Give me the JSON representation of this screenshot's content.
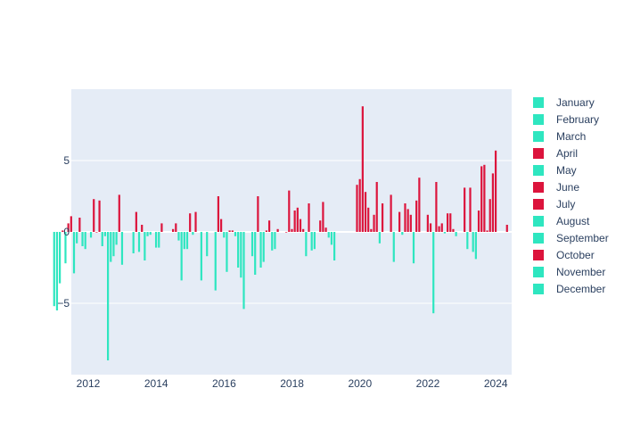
{
  "chart_data": {
    "type": "bar",
    "title": "",
    "xlabel": "",
    "ylabel": "",
    "xlim": [
      2011.55,
      2024.5
    ],
    "ylim": [
      -9.9,
      9.9
    ],
    "grid": true,
    "legend_position": "right",
    "x_ticks": [
      "2012",
      "2014",
      "2016",
      "2018",
      "2020",
      "2022",
      "2024"
    ],
    "x_tick_values": [
      2012,
      2014,
      2016,
      2018,
      2020,
      2022,
      2024
    ],
    "y_ticks": [
      "−5",
      "0",
      "5"
    ],
    "y_tick_values": [
      -5,
      0,
      5
    ],
    "colors": {
      "positive": "#dc143c",
      "negative": "#2ee6c0"
    },
    "legend": [
      {
        "name": "January",
        "color": "#2ee6c0"
      },
      {
        "name": "February",
        "color": "#2ee6c0"
      },
      {
        "name": "March",
        "color": "#2ee6c0"
      },
      {
        "name": "April",
        "color": "#dc143c"
      },
      {
        "name": "May",
        "color": "#2ee6c0"
      },
      {
        "name": "June",
        "color": "#dc143c"
      },
      {
        "name": "July",
        "color": "#dc143c"
      },
      {
        "name": "August",
        "color": "#2ee6c0"
      },
      {
        "name": "September",
        "color": "#2ee6c0"
      },
      {
        "name": "October",
        "color": "#dc143c"
      },
      {
        "name": "November",
        "color": "#2ee6c0"
      },
      {
        "name": "December",
        "color": "#2ee6c0"
      }
    ],
    "series": [
      {
        "date": "2011-09",
        "value": -5.2
      },
      {
        "date": "2011-10",
        "value": -5.5
      },
      {
        "date": "2011-11",
        "value": -3.6
      },
      {
        "date": "2011-12",
        "value": 0.1
      },
      {
        "date": "2012-01",
        "value": -2.2
      },
      {
        "date": "2012-02",
        "value": 0.6
      },
      {
        "date": "2012-03",
        "value": 1.1
      },
      {
        "date": "2012-04",
        "value": -2.9
      },
      {
        "date": "2012-05",
        "value": -0.8
      },
      {
        "date": "2012-06",
        "value": 1.0
      },
      {
        "date": "2012-07",
        "value": -1.0
      },
      {
        "date": "2012-08",
        "value": -1.2
      },
      {
        "date": "2012-10",
        "value": -0.4
      },
      {
        "date": "2012-11",
        "value": 2.3
      },
      {
        "date": "2012-12",
        "value": 0.0
      },
      {
        "date": "2013-01",
        "value": 2.2
      },
      {
        "date": "2013-02",
        "value": -1.0
      },
      {
        "date": "2013-03",
        "value": -0.3
      },
      {
        "date": "2013-04",
        "value": -9.0
      },
      {
        "date": "2013-05",
        "value": -2.1
      },
      {
        "date": "2013-06",
        "value": -1.7
      },
      {
        "date": "2013-07",
        "value": -0.9
      },
      {
        "date": "2013-08",
        "value": 2.6
      },
      {
        "date": "2013-09",
        "value": -2.3
      },
      {
        "date": "2014-01",
        "value": -1.5
      },
      {
        "date": "2014-02",
        "value": 1.4
      },
      {
        "date": "2014-03",
        "value": -1.4
      },
      {
        "date": "2014-04",
        "value": 0.5
      },
      {
        "date": "2014-05",
        "value": -2.0
      },
      {
        "date": "2014-06",
        "value": -0.3
      },
      {
        "date": "2014-07",
        "value": -0.2
      },
      {
        "date": "2014-09",
        "value": -1.1
      },
      {
        "date": "2014-10",
        "value": -1.1
      },
      {
        "date": "2014-11",
        "value": 0.6
      },
      {
        "date": "2015-03",
        "value": 0.2
      },
      {
        "date": "2015-04",
        "value": 0.6
      },
      {
        "date": "2015-05",
        "value": -0.6
      },
      {
        "date": "2015-06",
        "value": -3.4
      },
      {
        "date": "2015-07",
        "value": -1.2
      },
      {
        "date": "2015-08",
        "value": -1.2
      },
      {
        "date": "2015-09",
        "value": 1.3
      },
      {
        "date": "2015-10",
        "value": -0.2
      },
      {
        "date": "2015-11",
        "value": 1.4
      },
      {
        "date": "2016-01",
        "value": -3.4
      },
      {
        "date": "2016-03",
        "value": -1.7
      },
      {
        "date": "2016-06",
        "value": -4.1
      },
      {
        "date": "2016-07",
        "value": 2.5
      },
      {
        "date": "2016-08",
        "value": 0.9
      },
      {
        "date": "2016-09",
        "value": -0.4
      },
      {
        "date": "2016-10",
        "value": -2.8
      },
      {
        "date": "2016-11",
        "value": 0.1
      },
      {
        "date": "2016-12",
        "value": 0.1
      },
      {
        "date": "2017-01",
        "value": -0.3
      },
      {
        "date": "2017-02",
        "value": -2.5
      },
      {
        "date": "2017-03",
        "value": -3.2
      },
      {
        "date": "2017-04",
        "value": -5.4
      },
      {
        "date": "2017-07",
        "value": -1.7
      },
      {
        "date": "2017-08",
        "value": -3.0
      },
      {
        "date": "2017-09",
        "value": 2.5
      },
      {
        "date": "2017-10",
        "value": -2.5
      },
      {
        "date": "2017-11",
        "value": -2.1
      },
      {
        "date": "2017-12",
        "value": 0.1
      },
      {
        "date": "2018-01",
        "value": 0.8
      },
      {
        "date": "2018-02",
        "value": -1.3
      },
      {
        "date": "2018-03",
        "value": -1.2
      },
      {
        "date": "2018-04",
        "value": 0.2
      },
      {
        "date": "2018-07",
        "value": -0.0
      },
      {
        "date": "2018-08",
        "value": 2.9
      },
      {
        "date": "2018-09",
        "value": 0.2
      },
      {
        "date": "2018-10",
        "value": 1.5
      },
      {
        "date": "2018-11",
        "value": 1.7
      },
      {
        "date": "2018-12",
        "value": 0.9
      },
      {
        "date": "2019-01",
        "value": 0.2
      },
      {
        "date": "2019-02",
        "value": -1.7
      },
      {
        "date": "2019-03",
        "value": 2.0
      },
      {
        "date": "2019-04",
        "value": -1.3
      },
      {
        "date": "2019-05",
        "value": -1.2
      },
      {
        "date": "2019-07",
        "value": 0.8
      },
      {
        "date": "2019-08",
        "value": 2.1
      },
      {
        "date": "2019-09",
        "value": 0.3
      },
      {
        "date": "2019-10",
        "value": -0.4
      },
      {
        "date": "2019-11",
        "value": -0.9
      },
      {
        "date": "2019-12",
        "value": -2.0
      },
      {
        "date": "2020-08",
        "value": 3.3
      },
      {
        "date": "2020-09",
        "value": 3.7
      },
      {
        "date": "2020-10",
        "value": 8.8
      },
      {
        "date": "2020-11",
        "value": 2.8
      },
      {
        "date": "2020-12",
        "value": 1.7
      },
      {
        "date": "2021-01",
        "value": 0.2
      },
      {
        "date": "2021-02",
        "value": 1.2
      },
      {
        "date": "2021-03",
        "value": 3.5
      },
      {
        "date": "2021-04",
        "value": -0.8
      },
      {
        "date": "2021-05",
        "value": 2.0
      },
      {
        "date": "2021-08",
        "value": 2.6
      },
      {
        "date": "2021-09",
        "value": -2.1
      },
      {
        "date": "2021-11",
        "value": 1.4
      },
      {
        "date": "2021-12",
        "value": -0.2
      },
      {
        "date": "2022-01",
        "value": 2.0
      },
      {
        "date": "2022-02",
        "value": 1.6
      },
      {
        "date": "2022-03",
        "value": 1.2
      },
      {
        "date": "2022-04",
        "value": -2.2
      },
      {
        "date": "2022-05",
        "value": 2.2
      },
      {
        "date": "2022-06",
        "value": 3.8
      },
      {
        "date": "2022-09",
        "value": 1.2
      },
      {
        "date": "2022-10",
        "value": 0.6
      },
      {
        "date": "2022-11",
        "value": -5.7
      },
      {
        "date": "2022-12",
        "value": 3.5
      },
      {
        "date": "2023-01",
        "value": 0.4
      },
      {
        "date": "2023-02",
        "value": 0.6
      },
      {
        "date": "2023-03",
        "value": -0.1
      },
      {
        "date": "2023-04",
        "value": 1.3
      },
      {
        "date": "2023-05",
        "value": 1.3
      },
      {
        "date": "2023-06",
        "value": 0.2
      },
      {
        "date": "2023-07",
        "value": -0.3
      },
      {
        "date": "2023-10",
        "value": 3.1
      },
      {
        "date": "2023-11",
        "value": -1.2
      },
      {
        "date": "2023-12",
        "value": 3.1
      },
      {
        "date": "2024-01",
        "value": -1.4
      },
      {
        "date": "2024-02",
        "value": -1.9
      },
      {
        "date": "2024-03",
        "value": 1.5
      },
      {
        "date": "2024-04",
        "value": 4.6
      },
      {
        "date": "2024-05",
        "value": 4.7
      },
      {
        "date": "2024-06",
        "value": 0.1
      },
      {
        "date": "2024-07",
        "value": 2.3
      },
      {
        "date": "2024-08",
        "value": 4.1
      },
      {
        "date": "2024-09",
        "value": 5.7
      },
      {
        "date": "2025-01",
        "value": 0.5
      }
    ]
  }
}
